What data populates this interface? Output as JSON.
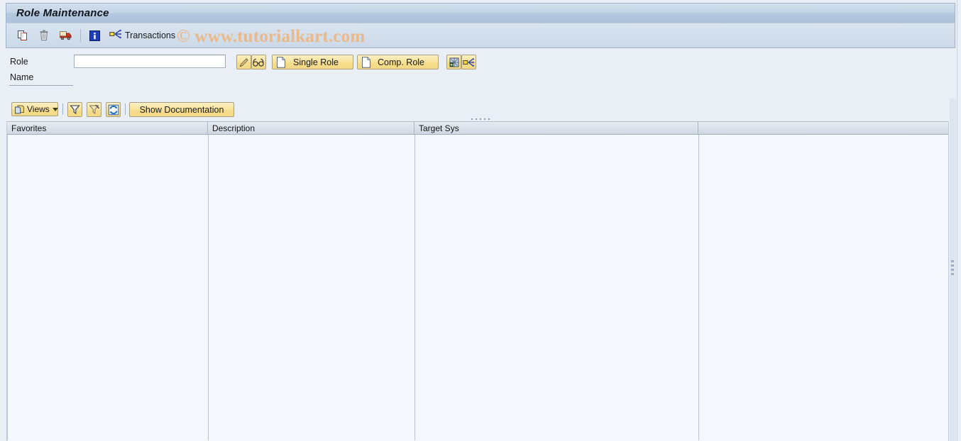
{
  "window": {
    "title": "Role Maintenance"
  },
  "toolbar": {
    "copy_role": {
      "label": "Copy Role",
      "icon": "copy-icon"
    },
    "delete_role": {
      "label": "Delete Role",
      "icon": "trash-icon"
    },
    "transport_role": {
      "label": "Transport Role",
      "icon": "truck-icon"
    },
    "info": {
      "label": "Information",
      "icon": "info-icon"
    },
    "transactions": {
      "label": "Transactions",
      "icon": "transactions-icon"
    }
  },
  "watermark": {
    "text": "© www.tutorialkart.com",
    "color": "#e9b98a"
  },
  "selection": {
    "role_label": "Role",
    "role_value": "",
    "role_placeholder": "",
    "name_label": "Name",
    "name_value": "",
    "change_button": {
      "label": "Change",
      "icon": "pencil-icon"
    },
    "display_button": {
      "label": "Display",
      "icon": "glasses-icon"
    },
    "single_role_button": {
      "label": "Single Role",
      "icon": "document-icon"
    },
    "comp_role_button": {
      "label": "Comp. Role",
      "icon": "document-icon"
    },
    "derive_button": {
      "label": "Derive Role",
      "icon": "derive-icon"
    },
    "transport_button": {
      "label": "Transport",
      "icon": "distribute-icon"
    }
  },
  "views_toolbar": {
    "views_button": {
      "label": "Views",
      "icon": "views-icon"
    },
    "filter_button": {
      "label": "Filter",
      "icon": "filter-icon"
    },
    "delete_filter_button": {
      "label": "Delete Filter",
      "icon": "filter-delete-icon"
    },
    "refresh_button": {
      "label": "Refresh",
      "icon": "refresh-icon"
    },
    "show_documentation_button": {
      "label": "Show Documentation"
    }
  },
  "table": {
    "columns": [
      {
        "label": "Favorites"
      },
      {
        "label": "Description"
      },
      {
        "label": "Target Sys"
      },
      {
        "label": ""
      }
    ],
    "rows": []
  },
  "colors": {
    "title_bar": "#b4c9de",
    "toolbar": "#ccd9e8",
    "button_yellow": "#f6dd8e",
    "canvas": "#eaeff5",
    "table_body": "#f5f8fd",
    "header_gray": "#d7dee6"
  }
}
